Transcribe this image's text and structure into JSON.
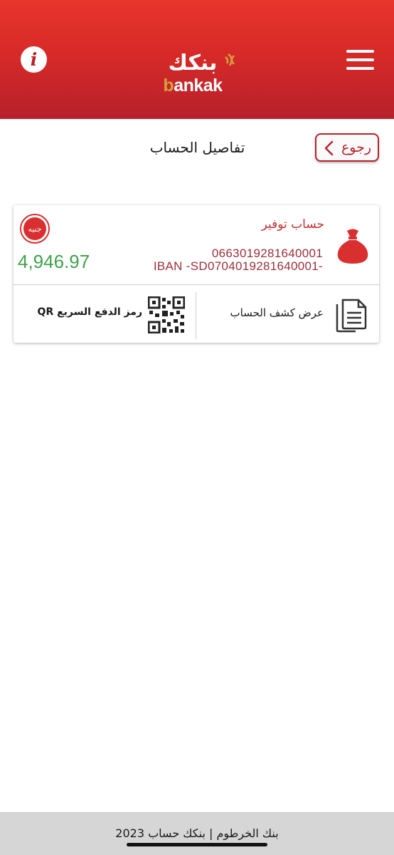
{
  "header": {
    "info_icon": "info-icon",
    "menu_icon": "hamburger-menu-icon",
    "logo_ar": "بنكك",
    "logo_en_first": "b",
    "logo_en_rest": "ankak",
    "colors": {
      "primary": "#d72a28",
      "primary_dark": "#b7202b",
      "logo_gold": "#d4a03c"
    }
  },
  "page": {
    "title": "تفاصيل الحساب",
    "back_label": "رجوع"
  },
  "account": {
    "currency_badge": "جنيه",
    "balance": "4,946.97",
    "name": "حساب توفير",
    "number": "0663019281640001",
    "iban": "IBAN -SD0704019281640001-",
    "colors": {
      "balance": "#3ea34a",
      "name": "#c23232",
      "details": "#9a2f3a"
    },
    "actions": {
      "statement_label": "عرض كشف الحساب",
      "qr_label": "رمز الدفع السريع QR"
    }
  },
  "footer": {
    "text": "2023 بنك الخرطوم | بنكك حساب"
  }
}
